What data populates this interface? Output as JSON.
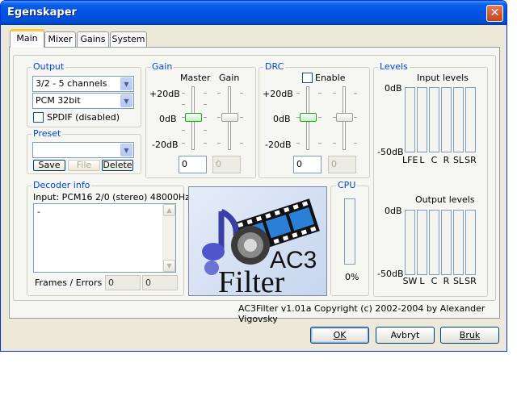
{
  "window": {
    "title": "Egenskaper",
    "close_icon": "✕"
  },
  "tabs": [
    "Main",
    "Mixer",
    "Gains",
    "System"
  ],
  "output": {
    "label": "Output",
    "channels": "3/2 - 5 channels",
    "format": "PCM 32bit",
    "spdif_label": "SPDIF (disabled)"
  },
  "preset": {
    "label": "Preset",
    "value": "",
    "save_label": "Save",
    "file_label": "File",
    "delete_label": "Delete"
  },
  "gain": {
    "label": "Gain",
    "master_label": "Master",
    "gain_label": "Gain",
    "scale": [
      "+20dB",
      "0dB",
      "-20dB"
    ],
    "master_value": "0",
    "gain_value": "0"
  },
  "drc": {
    "label": "DRC",
    "enable_label": "Enable",
    "scale": [
      "+20dB",
      "0dB",
      "-20dB"
    ],
    "value": "0",
    "value2": "0"
  },
  "levels": {
    "label": "Levels",
    "input_title": "Input levels",
    "input_top": "0dB",
    "input_bottom": "-50dB",
    "input_channels": [
      "LFE",
      "L",
      "C",
      "R",
      "SL",
      "SR"
    ],
    "output_title": "Output levels",
    "output_top": "0dB",
    "output_bottom": "-50dB",
    "output_channels": [
      "SW",
      "L",
      "C",
      "R",
      "SL",
      "SR"
    ]
  },
  "decoder": {
    "label": "Decoder info",
    "input_info": "Input: PCM16 2/0 (stereo) 48000Hz",
    "memo_text": "-",
    "frames_label": "Frames / Errors",
    "frames_value": "0",
    "errors_value": "0"
  },
  "cpu": {
    "label": "CPU",
    "value": "0%"
  },
  "logo": {
    "text_ac3": "AC3",
    "text_filter": "Filter"
  },
  "copyright": "AC3Filter v1.01a Copyright (c) 2002-2004 by Alexander Vigovsky",
  "buttons": {
    "ok": "OK",
    "cancel": "Avbryt",
    "apply": "Bruk"
  }
}
